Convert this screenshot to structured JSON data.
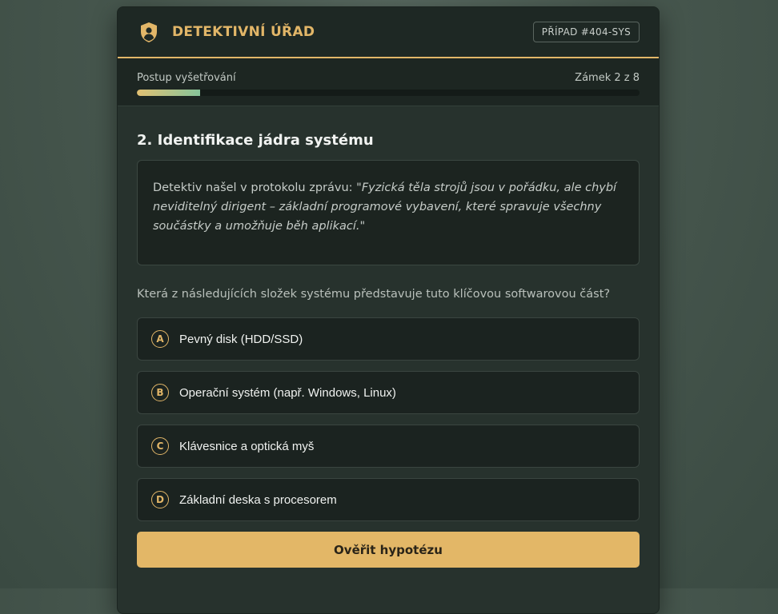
{
  "header": {
    "brand": "DETEKTIVNÍ ÚŘAD",
    "case_badge": "PŘÍPAD #404-SYS",
    "logo_icon": "shield-user-icon"
  },
  "progress": {
    "label": "Postup vyšetřování",
    "counter": "Zámek 2 z 8",
    "fraction": 0.125
  },
  "question": {
    "title": "2. Identifikace jádra systému",
    "story_prefix": "Detektiv našel v protokolu zprávu: ",
    "story_quote": "\"Fyzická těla strojů jsou v pořádku, ale chybí neviditelný dirigent – základní programové vybavení, které spravuje všechny součástky a umožňuje běh aplikací.\"",
    "prompt": "Která z následujících složek systému představuje tuto klíčovou softwarovou část?"
  },
  "options": [
    {
      "letter": "A",
      "text": "Pevný disk (HDD/SSD)"
    },
    {
      "letter": "B",
      "text": "Operační systém (např. Windows, Linux)"
    },
    {
      "letter": "C",
      "text": "Klávesnice a optická myš"
    },
    {
      "letter": "D",
      "text": "Základní deska s procesorem"
    }
  ],
  "submit_label": "Ověřit hypotézu",
  "colors": {
    "accent": "#e2b668",
    "progress_start": "#e2c173",
    "progress_end": "#86c49a"
  }
}
